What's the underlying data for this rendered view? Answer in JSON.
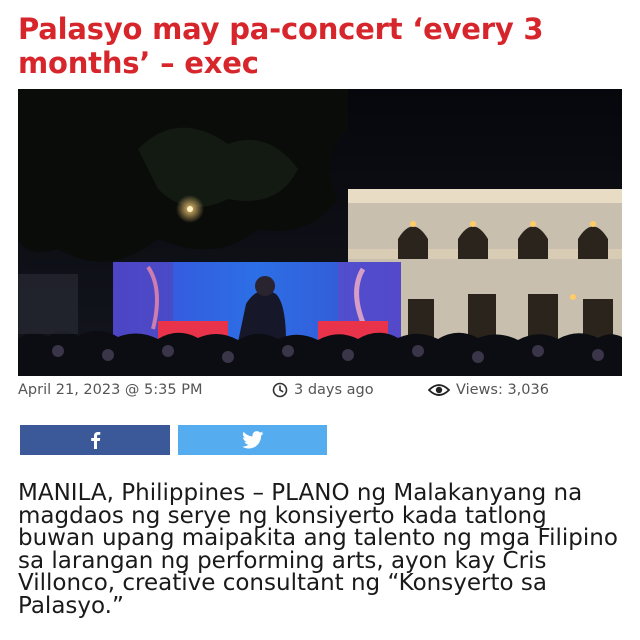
{
  "article": {
    "title": "Palasyo may pa-concert ‘every 3 months’ – exec",
    "date": "April 21, 2023 @ 5:35 PM",
    "relative_time": "3 days ago",
    "views": "Views: 3,036",
    "body": "MANILA, Philippines – PLANO ng Malakanyang na magdaos ng serye ng konsiyerto kada tatlong buwan upang maipakita ang talento ng mga Filipino sa larangan ng performing arts, ayon kay Cris Villonco, creative consultant ng “Konsyerto sa Palasyo.”"
  },
  "share": {
    "facebook_icon": "facebook-icon",
    "twitter_icon": "twitter-icon",
    "facebook_color": "#3b5998",
    "twitter_color": "#55acee"
  },
  "theme": {
    "headline_color": "#d7262b"
  }
}
